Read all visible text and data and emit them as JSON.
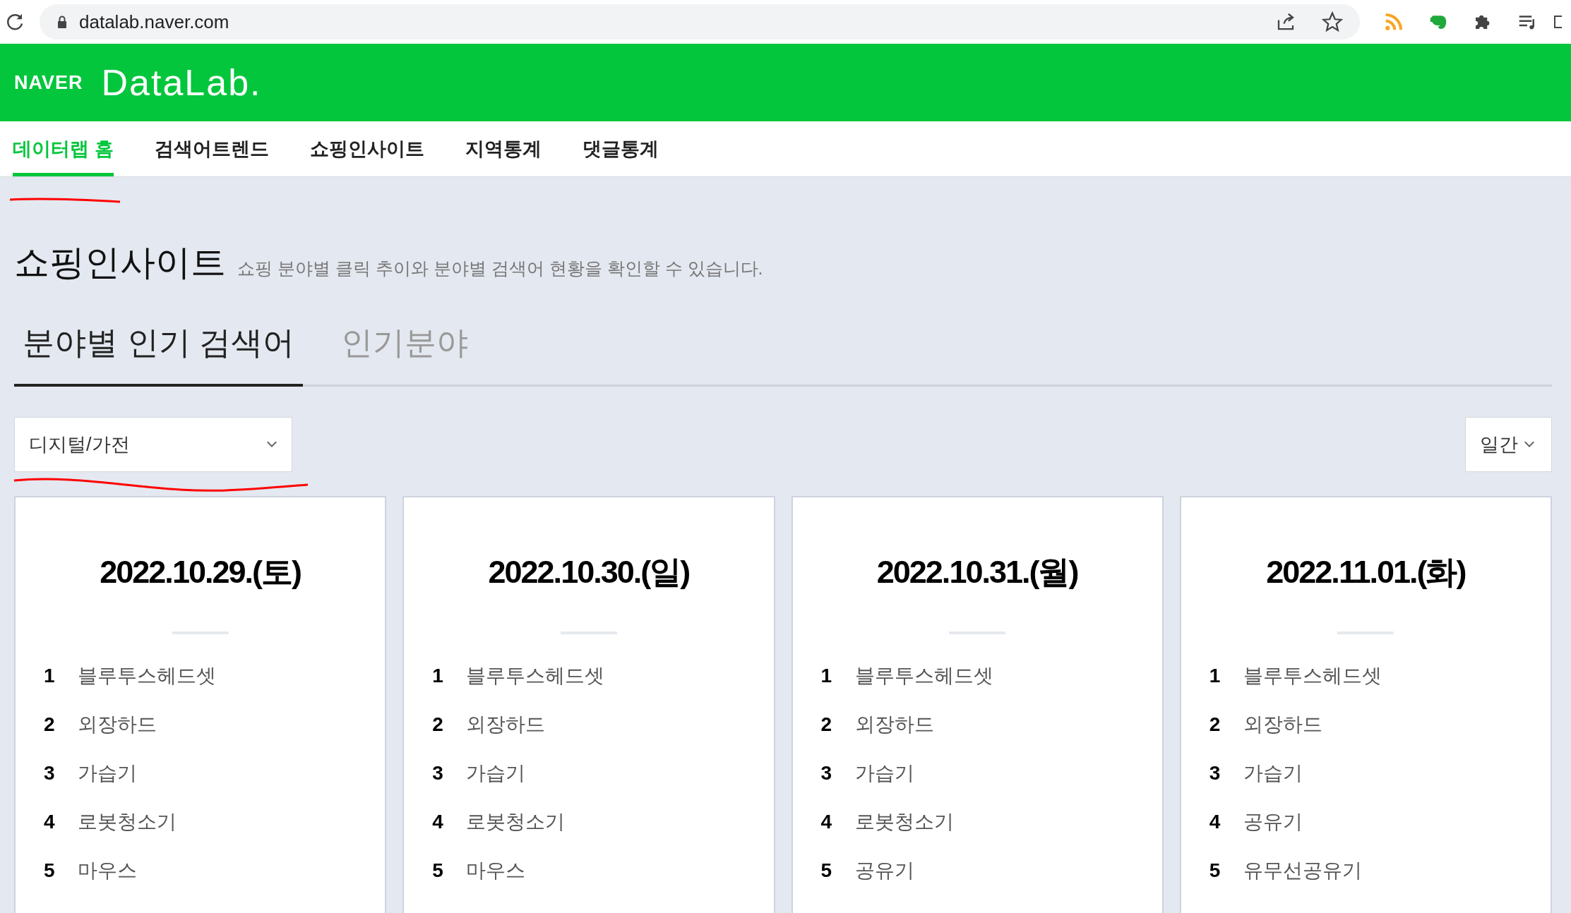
{
  "browser": {
    "url": "datalab.naver.com"
  },
  "header": {
    "brand": "NAVER",
    "product": "DataLab."
  },
  "nav": [
    {
      "label": "데이터랩 홈",
      "selected": true
    },
    {
      "label": "검색어트렌드",
      "selected": false
    },
    {
      "label": "쇼핑인사이트",
      "selected": false
    },
    {
      "label": "지역통계",
      "selected": false
    },
    {
      "label": "댓글통계",
      "selected": false
    }
  ],
  "page": {
    "title": "쇼핑인사이트",
    "description": "쇼핑 분야별 클릭 추이와 분야별 검색어 현황을 확인할 수 있습니다."
  },
  "tabs": [
    {
      "label": "분야별 인기 검색어",
      "selected": true
    },
    {
      "label": "인기분야",
      "selected": false
    }
  ],
  "category_select": {
    "value": "디지털/가전"
  },
  "period_select": {
    "value": "일간"
  },
  "cards": [
    {
      "date": "2022.10.29.(토)",
      "items": [
        {
          "rank": "1",
          "keyword": "블루투스헤드셋"
        },
        {
          "rank": "2",
          "keyword": "외장하드"
        },
        {
          "rank": "3",
          "keyword": "가습기"
        },
        {
          "rank": "4",
          "keyword": "로봇청소기"
        },
        {
          "rank": "5",
          "keyword": "마우스"
        }
      ]
    },
    {
      "date": "2022.10.30.(일)",
      "items": [
        {
          "rank": "1",
          "keyword": "블루투스헤드셋"
        },
        {
          "rank": "2",
          "keyword": "외장하드"
        },
        {
          "rank": "3",
          "keyword": "가습기"
        },
        {
          "rank": "4",
          "keyword": "로봇청소기"
        },
        {
          "rank": "5",
          "keyword": "마우스"
        }
      ]
    },
    {
      "date": "2022.10.31.(월)",
      "items": [
        {
          "rank": "1",
          "keyword": "블루투스헤드셋"
        },
        {
          "rank": "2",
          "keyword": "외장하드"
        },
        {
          "rank": "3",
          "keyword": "가습기"
        },
        {
          "rank": "4",
          "keyword": "로봇청소기"
        },
        {
          "rank": "5",
          "keyword": "공유기"
        }
      ]
    },
    {
      "date": "2022.11.01.(화)",
      "items": [
        {
          "rank": "1",
          "keyword": "블루투스헤드셋"
        },
        {
          "rank": "2",
          "keyword": "외장하드"
        },
        {
          "rank": "3",
          "keyword": "가습기"
        },
        {
          "rank": "4",
          "keyword": "공유기"
        },
        {
          "rank": "5",
          "keyword": "유무선공유기"
        }
      ]
    }
  ]
}
